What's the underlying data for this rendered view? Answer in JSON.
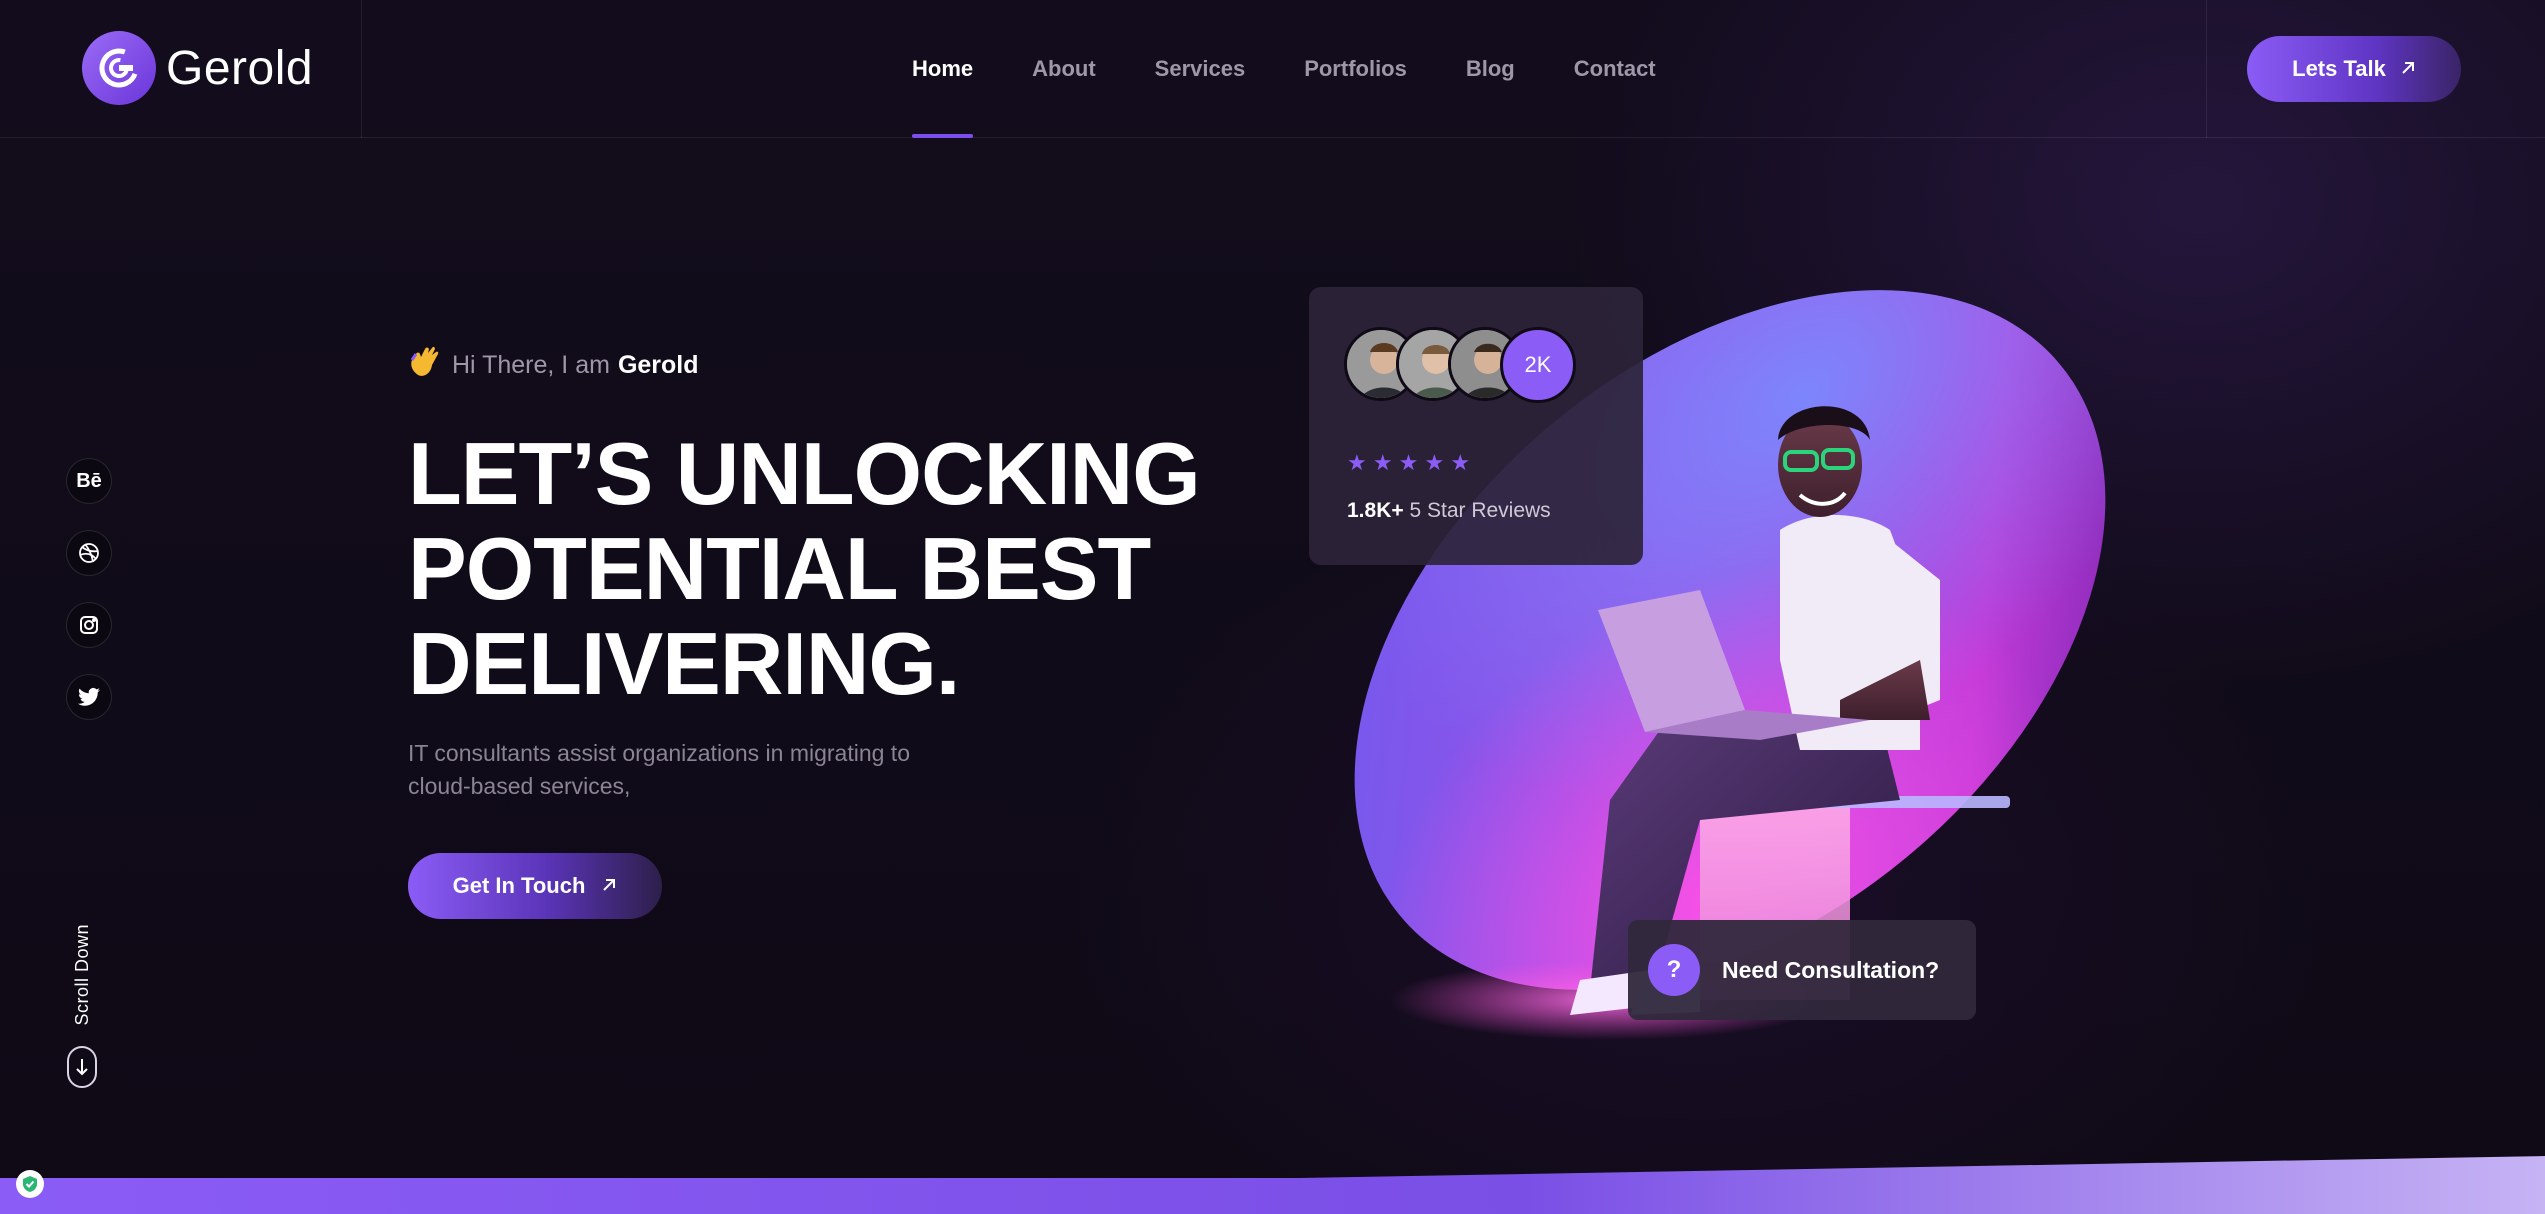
{
  "header": {
    "logo_text": "Gerold",
    "nav": [
      {
        "label": "Home",
        "active": true
      },
      {
        "label": "About",
        "active": false
      },
      {
        "label": "Services",
        "active": false
      },
      {
        "label": "Portfolios",
        "active": false
      },
      {
        "label": "Blog",
        "active": false
      },
      {
        "label": "Contact",
        "active": false
      }
    ],
    "cta_label": "Lets Talk"
  },
  "social": {
    "behance_label": "Bē",
    "icons": [
      "behance-icon",
      "dribbble-icon",
      "instagram-icon",
      "twitter-icon"
    ]
  },
  "scroll": {
    "label": "Scroll Down"
  },
  "hero": {
    "greeting_prefix": "Hi There, I am",
    "greeting_name": "Gerold",
    "headline_line1": "LET’S UNLOCKING",
    "headline_line2": "POTENTIAL BEST",
    "headline_line3": "DELIVERING.",
    "subtext": "IT consultants assist organizations in migrating to cloud-based services,",
    "cta_label": "Get In Touch"
  },
  "reviews": {
    "count_badge": "2K",
    "stars": "★ ★ ★ ★ ★",
    "rating": 5,
    "count_bold": "1.8K+",
    "count_text": "5 Star Reviews"
  },
  "consultation": {
    "badge": "?",
    "label": "Need Consultation?"
  },
  "colors": {
    "accent": "#8b5cf6",
    "background": "#100b18",
    "muted_text": "#9d97a8"
  }
}
